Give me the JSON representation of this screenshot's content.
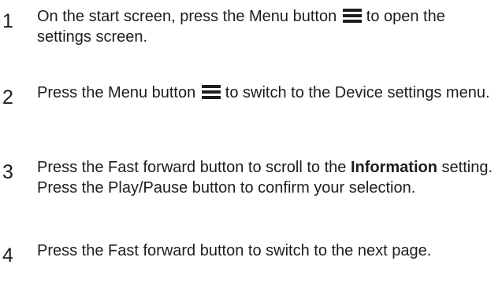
{
  "steps": [
    {
      "number": "1",
      "before_icon": "On the start screen, press the Menu button ",
      "icon": "menu-icon",
      "after_icon": "to open the settings screen."
    },
    {
      "number": "2",
      "before_icon": "Press the Menu button ",
      "icon": "menu-icon",
      "after_icon": "to switch to the Device settings menu."
    },
    {
      "number": "3",
      "text_before_bold": "Press the Fast forward button to scroll to the ",
      "bold": "Information",
      "text_after_bold": " setting. Press the Play/Pause button to confirm your selection."
    },
    {
      "number": "4",
      "text": "Press the Fast forward button to switch to the next page."
    }
  ]
}
